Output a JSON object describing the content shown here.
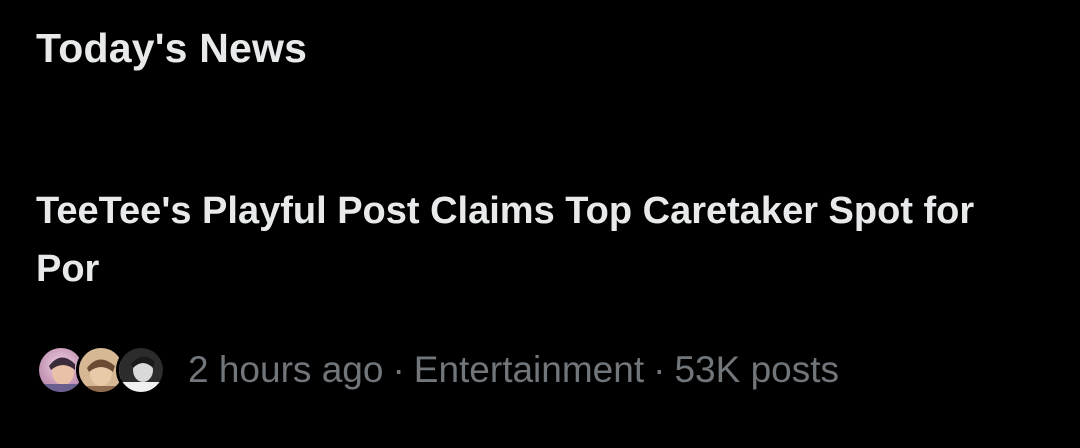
{
  "section": {
    "title": "Today's News"
  },
  "story": {
    "headline": "TeeTee's Playful Post Claims Top Caretaker Spot for Por",
    "time_ago": "2 hours ago",
    "separator": "·",
    "category": "Entertainment",
    "post_count": "53K posts",
    "avatars": [
      {
        "icon": "avatar-1-photo",
        "color": "#c58fb0"
      },
      {
        "icon": "avatar-2-photo",
        "color": "#c9a27e"
      },
      {
        "icon": "avatar-3-photo",
        "color": "#5a5a5a"
      }
    ]
  },
  "colors": {
    "background": "#000000",
    "primary_text": "#e7e9ea",
    "secondary_text": "#71767b"
  }
}
